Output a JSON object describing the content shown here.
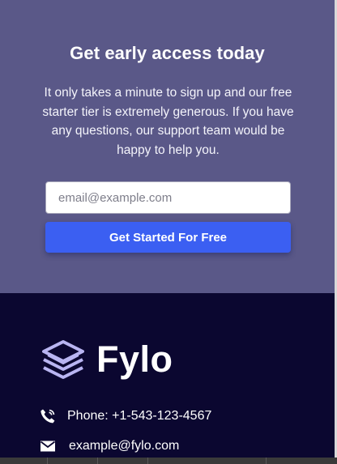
{
  "cta": {
    "title": "Get early access today",
    "description": "It only takes a minute to sign up and our free starter tier is extremely generous. If you have any questions, our support team would be happy to help you.",
    "email_placeholder": "email@example.com",
    "button_label": "Get Started For Free"
  },
  "footer": {
    "logo_text": "Fylo",
    "phone": "Phone: +1-543-123-4567",
    "email": "example@fylo.com"
  },
  "colors": {
    "cta_background": "#5a5888",
    "button": "#3b5ff2",
    "footer_background": "#0b0730",
    "logo_mark": "#b9b5f2"
  },
  "icons": {
    "logo": "stacked-layers-icon",
    "phone": "phone-icon",
    "email": "envelope-icon"
  }
}
